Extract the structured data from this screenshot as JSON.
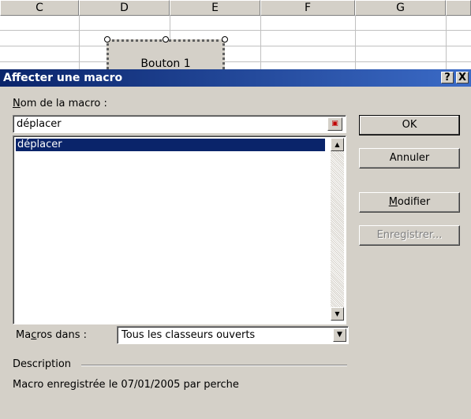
{
  "sheet": {
    "columns": [
      "C",
      "D",
      "E",
      "F",
      "G"
    ],
    "button_label": "Bouton 1"
  },
  "dialog": {
    "title": "Affecter une macro",
    "help_btn": "?",
    "close_btn": "X",
    "name_label_key": "N",
    "name_label_rest": "om de la macro :",
    "name_value": "déplacer",
    "list_items": [
      "déplacer"
    ],
    "ok_label": "OK",
    "cancel_label": "Annuler",
    "modify_key": "M",
    "modify_rest": "odifier",
    "record_label": "Enregistrer...",
    "macros_in_pre": "Ma",
    "macros_in_key": "c",
    "macros_in_post": "ros dans :",
    "macros_in_value": "Tous les classeurs ouverts",
    "description_label": "Description",
    "description_text": "Macro enregistrée le 07/01/2005 par perche"
  }
}
